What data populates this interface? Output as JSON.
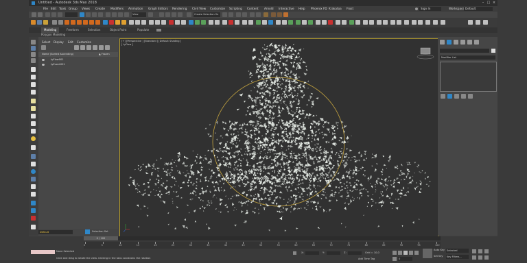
{
  "window": {
    "title": "Untitled - Autodesk 3ds Max 2018",
    "signin": "Sign In",
    "workspaces_label": "Workspaces:",
    "workspace_value": "Default"
  },
  "menu": [
    "File",
    "Edit",
    "Tools",
    "Group",
    "Views",
    "Create",
    "Modifiers",
    "Animation",
    "Graph Editors",
    "Rendering",
    "Civil View",
    "Customize",
    "Scripting",
    "Content",
    "Arnold",
    "Interactive",
    "Help",
    "Phoenix FD",
    "Krakatoa",
    "Frost"
  ],
  "toolbar": {
    "view_dropdown": "View",
    "selection_set": "Create Selection Se"
  },
  "ribbon": {
    "tabs": [
      "Modeling",
      "Freeform",
      "Selection",
      "Object Paint",
      "Populate"
    ],
    "sub": "Polygon Modeling"
  },
  "scene_explorer": {
    "menu": [
      "Select",
      "Display",
      "Edit",
      "Customize"
    ],
    "col_name": "Name (Sorted Ascending)",
    "col_frozen": "▲ Frozen",
    "items": [
      "tyFlow001",
      "tyEvent001"
    ]
  },
  "viewport": {
    "label1": "[+] [Perspective ] [Standard ] [Default Shading ]",
    "label2": "[ tyFlow ]"
  },
  "right_panel": {
    "modifier_list": "Modifier List"
  },
  "layer": {
    "name": "Default",
    "selection_set": "Selection Set"
  },
  "timeline": {
    "frame": "0 / 100",
    "ticks": [
      "0",
      "5",
      "10",
      "15",
      "20",
      "25",
      "30",
      "35",
      "40",
      "45",
      "50",
      "55",
      "60",
      "65",
      "70",
      "75",
      "80",
      "85",
      "90",
      "95",
      "100"
    ]
  },
  "status": {
    "selected": "None Selected",
    "prompt": "Click and drag to rotate the view.  Clicking in the tabs constrains the rotation",
    "x_label": "X:",
    "x_value": "",
    "y_label": "Y:",
    "y_value": "",
    "z_label": "Z:",
    "z_value": "",
    "grid": "Grid = 10,0",
    "add_time_tag": "Add Time Tag",
    "auto_key": "Auto Key",
    "set_key": "Set Key",
    "selected_dd": "Selected",
    "key_filters": "Key Filters...",
    "frame_field": "0"
  },
  "colors": {
    "accent": "#2f87c8",
    "viewport_border": "#b39b2a",
    "particles": "#e6ece6",
    "emitter_circle": "#b89a3e"
  }
}
